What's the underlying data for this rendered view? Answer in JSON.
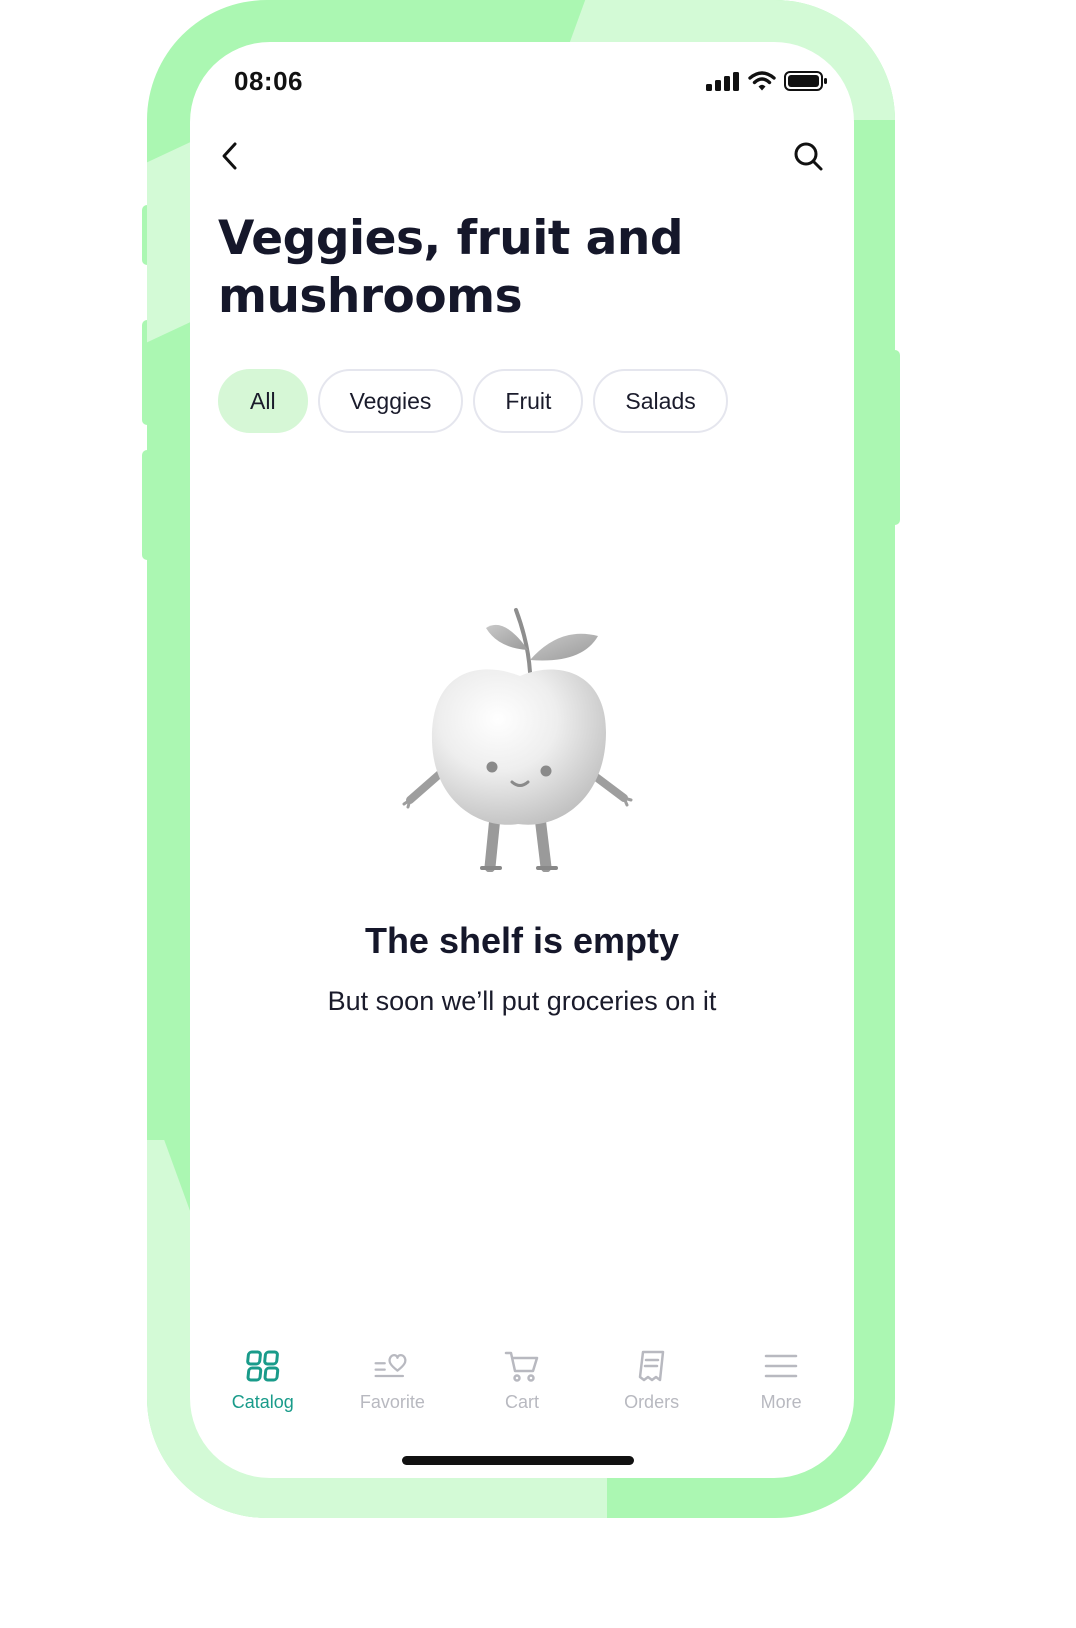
{
  "status_bar": {
    "time": "08:06",
    "icons": [
      "signal-icon",
      "wifi-icon",
      "battery-icon"
    ]
  },
  "header": {
    "back_icon": "chevron-left-icon",
    "search_icon": "search-icon",
    "title": "Veggies, fruit and mushrooms"
  },
  "filters": {
    "selected": "All",
    "chips": [
      {
        "label": "All"
      },
      {
        "label": "Veggies"
      },
      {
        "label": "Fruit"
      },
      {
        "label": "Salads"
      }
    ]
  },
  "empty_state": {
    "illustration": "apple-character-illustration",
    "title": "The shelf is empty",
    "subtitle": "But soon we’ll put groceries on it"
  },
  "tabbar": {
    "active": "Catalog",
    "tabs": [
      {
        "label": "Catalog",
        "icon": "grid-icon"
      },
      {
        "label": "Favorite",
        "icon": "heart-list-icon"
      },
      {
        "label": "Cart",
        "icon": "cart-icon"
      },
      {
        "label": "Orders",
        "icon": "receipt-icon"
      },
      {
        "label": "More",
        "icon": "menu-icon"
      }
    ]
  },
  "colors": {
    "frame": "#abf7b2",
    "frame_highlight": "#d3fad6",
    "chip_active": "#d6f7d6",
    "accent": "#199b8a",
    "title": "#15172a",
    "tab_inactive": "#b8b9c0"
  }
}
